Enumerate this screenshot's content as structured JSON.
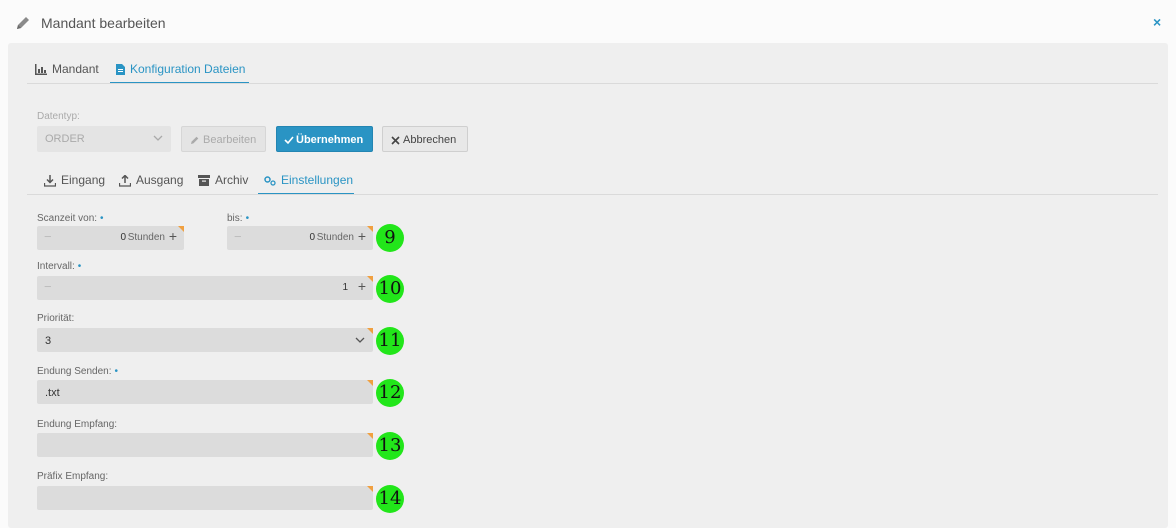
{
  "window": {
    "title": "Mandant bearbeiten",
    "close": "×"
  },
  "tabs_top": [
    {
      "label": "Mandant",
      "icon": "chart-icon"
    },
    {
      "label": "Konfiguration Dateien",
      "icon": "file-icon"
    }
  ],
  "datentyp": {
    "label": "Datentyp:",
    "value": "ORDER",
    "btn_edit": "Bearbeiten",
    "btn_apply": "Übernehmen",
    "btn_cancel": "Abbrechen"
  },
  "tabs_sub": [
    {
      "label": "Eingang",
      "icon": "download-icon"
    },
    {
      "label": "Ausgang",
      "icon": "upload-icon"
    },
    {
      "label": "Archiv",
      "icon": "archive-icon"
    },
    {
      "label": "Einstellungen",
      "icon": "settings-icon"
    }
  ],
  "form": {
    "scan_from": {
      "label": "Scanzeit von:",
      "req": "•",
      "value": "0",
      "unit": "Stunden"
    },
    "scan_to": {
      "label": "bis:",
      "req": "•",
      "value": "0",
      "unit": "Stunden"
    },
    "interval": {
      "label": "Intervall:",
      "req": "•",
      "value": "1"
    },
    "priority": {
      "label": "Priorität:",
      "value": "3"
    },
    "ext_send": {
      "label": "Endung Senden:",
      "req": "•",
      "value": ".txt"
    },
    "ext_recv": {
      "label": "Endung Empfang:",
      "value": ""
    },
    "prefix_recv": {
      "label": "Präfix Empfang:",
      "value": ""
    }
  },
  "badges": [
    "9",
    "10",
    "11",
    "12",
    "13",
    "14"
  ],
  "colors": {
    "accent": "#2a94c4",
    "badge": "#22e61a",
    "required_corner": "#f0a040"
  }
}
